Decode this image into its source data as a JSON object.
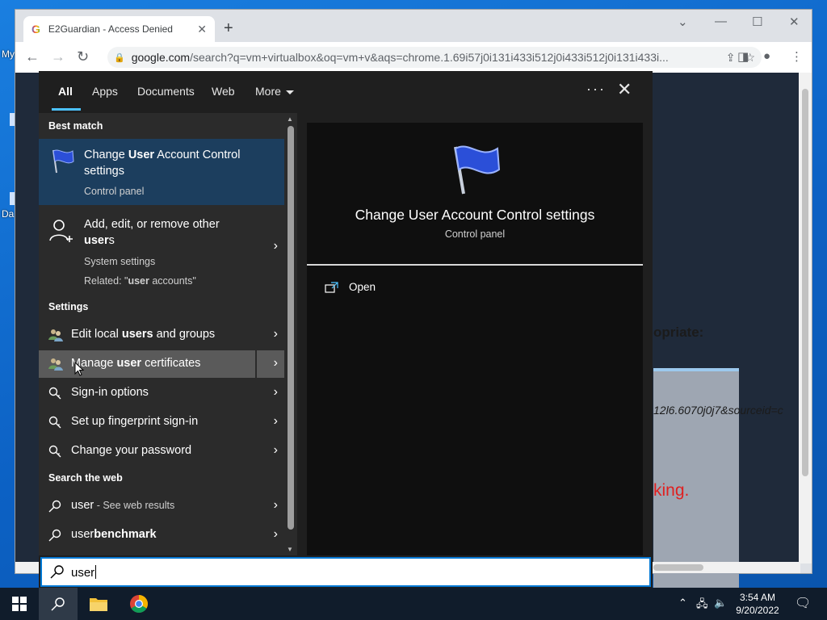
{
  "desktop": {
    "icon_label_1": "My",
    "icon_label_2": "Da"
  },
  "browser": {
    "tab_title": "E2Guardian - Access Denied",
    "new_tab": "+",
    "url_host": "google.com",
    "url_rest": "/search?q=vm+virtualbox&oq=vm+v&aqs=chrome.1.69i57j0i131i433i512j0i433i512j0i131i433i...",
    "page_peek": {
      "heading_fragment": "opriate:",
      "url_fragment": "12l6.6070j0j7&sourceid=c",
      "warning_fragment": "king."
    }
  },
  "search_menu": {
    "tabs": [
      {
        "label": "All",
        "active": true
      },
      {
        "label": "Apps",
        "active": false
      },
      {
        "label": "Documents",
        "active": false
      },
      {
        "label": "Web",
        "active": false
      },
      {
        "label": "More",
        "active": false
      }
    ],
    "sections": {
      "best_match": "Best match",
      "settings": "Settings",
      "search_the_web": "Search the web"
    },
    "best_match": {
      "title_prefix": "Change ",
      "title_highlight": "User",
      "title_suffix": " Account Control settings",
      "subtitle": "Control panel",
      "icon": "flag-icon"
    },
    "system_result": {
      "title_line1": "Add, edit, or remove other",
      "title_highlight": "user",
      "title_suffix": "s",
      "subtitle": "System settings",
      "related_prefix": "Related: \"",
      "related_highlight": "user",
      "related_suffix": " accounts\"",
      "icon": "add-user-icon"
    },
    "settings_items": [
      {
        "pre": "Edit local ",
        "hl": "users",
        "post": " and groups",
        "icon": "users-group-icon"
      },
      {
        "pre": "Manage ",
        "hl": "user",
        "post": " certificates",
        "icon": "users-group-icon",
        "hovered": true
      },
      {
        "pre": "Sign-in options",
        "hl": "",
        "post": "",
        "icon": "key-icon"
      },
      {
        "pre": "Set up fingerprint sign-in",
        "hl": "",
        "post": "",
        "icon": "key-icon"
      },
      {
        "pre": "Change your password",
        "hl": "",
        "post": "",
        "icon": "key-icon"
      }
    ],
    "web_items": [
      {
        "query": "user",
        "suffix": " - See web results"
      },
      {
        "query_prefix": "user",
        "query_bold": "benchmark"
      }
    ],
    "preview": {
      "title": "Change User Account Control settings",
      "subtitle": "Control panel",
      "action_open": "Open"
    },
    "query": "user"
  },
  "taskbar": {
    "time": "3:54 AM",
    "date": "9/20/2022"
  },
  "colors": {
    "accent": "#4cc2ff",
    "best_match_bg": "#1c3e5e",
    "panel_bg": "#1f1f1f",
    "taskbar_bg": "#101c2b"
  }
}
